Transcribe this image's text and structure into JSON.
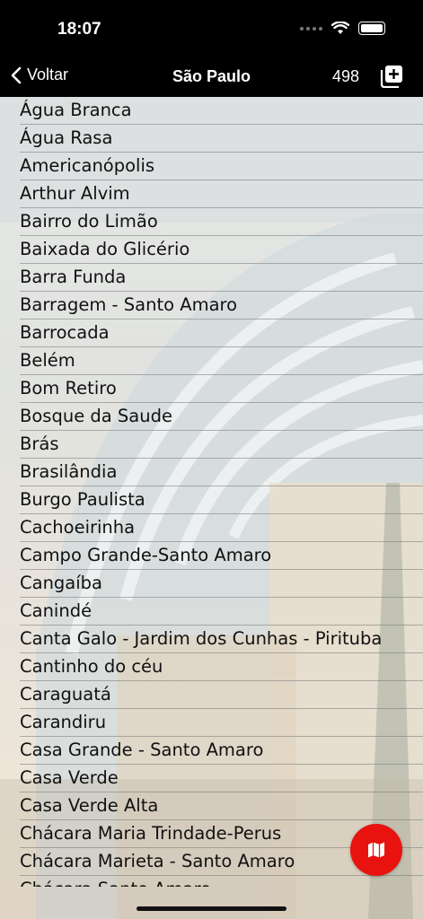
{
  "status_bar": {
    "time": "18:07"
  },
  "nav": {
    "back_label": "Voltar",
    "title": "São Paulo",
    "count": "498"
  },
  "icons": {
    "back": "chevron-left-icon",
    "add": "plus-square-icon",
    "map": "map-icon"
  },
  "colors": {
    "accent": "#e8130f",
    "bar": "#000000"
  },
  "districts": [
    "Água Branca",
    "Água Rasa",
    "Americanópolis",
    "Arthur Alvim",
    "Bairro do Limão",
    "Baixada do Glicério",
    "Barra Funda",
    "Barragem - Santo Amaro",
    "Barrocada",
    "Belém",
    "Bom Retiro",
    "Bosque da Saude",
    "Brás",
    "Brasilândia",
    "Burgo Paulista",
    "Cachoeirinha",
    "Campo Grande-Santo Amaro",
    "Cangaíba",
    "Canindé",
    "Canta Galo - Jardim dos Cunhas - Pirituba",
    "Cantinho do céu",
    "Caraguatá",
    "Carandiru",
    "Casa Grande - Santo Amaro",
    "Casa Verde",
    "Casa Verde Alta",
    "Chácara Maria Trindade-Perus",
    "Chácara Marieta - Santo Amaro",
    "Chácara Santo Amaro"
  ]
}
